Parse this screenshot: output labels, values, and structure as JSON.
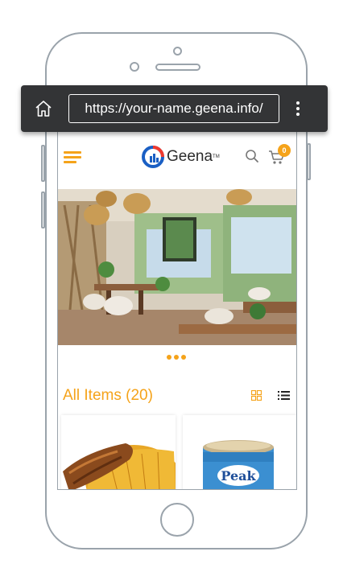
{
  "browser": {
    "url": "https://your-name.geena.info/",
    "home_icon": "home-icon",
    "menu_icon": "kebab-menu-icon"
  },
  "header": {
    "brand": "Geena",
    "trademark": "TM",
    "menu_icon": "hamburger-icon",
    "search_icon": "search-icon",
    "cart_icon": "cart-icon",
    "cart_count": "0"
  },
  "carousel": {
    "slide_count": 3,
    "image": "restaurant-interior"
  },
  "products": {
    "title": "All Items (20)",
    "view_grid_icon": "grid-view-icon",
    "view_list_icon": "list-view-icon",
    "items": [
      {
        "image": "fried-fish-with-rice"
      },
      {
        "image": "peak-milk-can"
      }
    ]
  },
  "colors": {
    "accent": "#f5a31a",
    "browser_bar": "#333436",
    "frame": "#9aa3ab"
  }
}
